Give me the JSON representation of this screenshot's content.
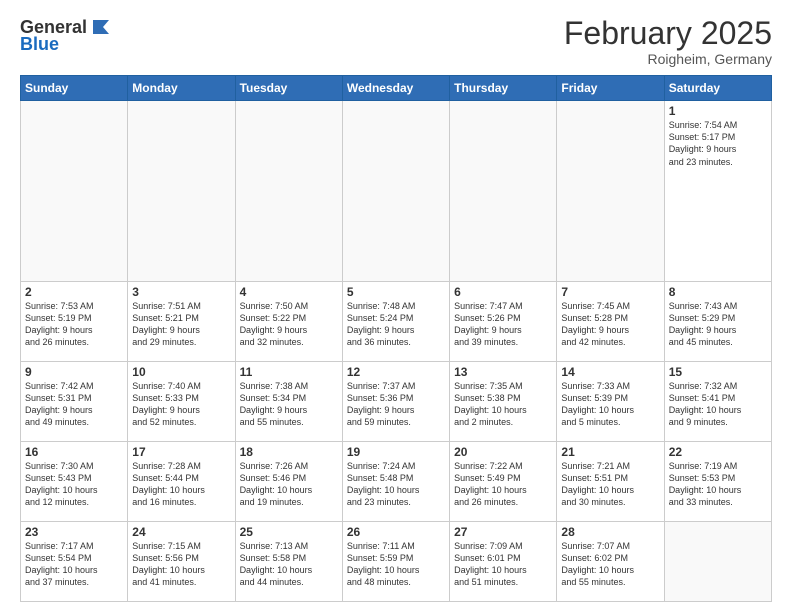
{
  "header": {
    "logo_line1": "General",
    "logo_line2": "Blue",
    "month": "February 2025",
    "location": "Roigheim, Germany"
  },
  "weekdays": [
    "Sunday",
    "Monday",
    "Tuesday",
    "Wednesday",
    "Thursday",
    "Friday",
    "Saturday"
  ],
  "weeks": [
    [
      {
        "day": "",
        "info": ""
      },
      {
        "day": "",
        "info": ""
      },
      {
        "day": "",
        "info": ""
      },
      {
        "day": "",
        "info": ""
      },
      {
        "day": "",
        "info": ""
      },
      {
        "day": "",
        "info": ""
      },
      {
        "day": "1",
        "info": "Sunrise: 7:54 AM\nSunset: 5:17 PM\nDaylight: 9 hours\nand 23 minutes."
      }
    ],
    [
      {
        "day": "2",
        "info": "Sunrise: 7:53 AM\nSunset: 5:19 PM\nDaylight: 9 hours\nand 26 minutes."
      },
      {
        "day": "3",
        "info": "Sunrise: 7:51 AM\nSunset: 5:21 PM\nDaylight: 9 hours\nand 29 minutes."
      },
      {
        "day": "4",
        "info": "Sunrise: 7:50 AM\nSunset: 5:22 PM\nDaylight: 9 hours\nand 32 minutes."
      },
      {
        "day": "5",
        "info": "Sunrise: 7:48 AM\nSunset: 5:24 PM\nDaylight: 9 hours\nand 36 minutes."
      },
      {
        "day": "6",
        "info": "Sunrise: 7:47 AM\nSunset: 5:26 PM\nDaylight: 9 hours\nand 39 minutes."
      },
      {
        "day": "7",
        "info": "Sunrise: 7:45 AM\nSunset: 5:28 PM\nDaylight: 9 hours\nand 42 minutes."
      },
      {
        "day": "8",
        "info": "Sunrise: 7:43 AM\nSunset: 5:29 PM\nDaylight: 9 hours\nand 45 minutes."
      }
    ],
    [
      {
        "day": "9",
        "info": "Sunrise: 7:42 AM\nSunset: 5:31 PM\nDaylight: 9 hours\nand 49 minutes."
      },
      {
        "day": "10",
        "info": "Sunrise: 7:40 AM\nSunset: 5:33 PM\nDaylight: 9 hours\nand 52 minutes."
      },
      {
        "day": "11",
        "info": "Sunrise: 7:38 AM\nSunset: 5:34 PM\nDaylight: 9 hours\nand 55 minutes."
      },
      {
        "day": "12",
        "info": "Sunrise: 7:37 AM\nSunset: 5:36 PM\nDaylight: 9 hours\nand 59 minutes."
      },
      {
        "day": "13",
        "info": "Sunrise: 7:35 AM\nSunset: 5:38 PM\nDaylight: 10 hours\nand 2 minutes."
      },
      {
        "day": "14",
        "info": "Sunrise: 7:33 AM\nSunset: 5:39 PM\nDaylight: 10 hours\nand 5 minutes."
      },
      {
        "day": "15",
        "info": "Sunrise: 7:32 AM\nSunset: 5:41 PM\nDaylight: 10 hours\nand 9 minutes."
      }
    ],
    [
      {
        "day": "16",
        "info": "Sunrise: 7:30 AM\nSunset: 5:43 PM\nDaylight: 10 hours\nand 12 minutes."
      },
      {
        "day": "17",
        "info": "Sunrise: 7:28 AM\nSunset: 5:44 PM\nDaylight: 10 hours\nand 16 minutes."
      },
      {
        "day": "18",
        "info": "Sunrise: 7:26 AM\nSunset: 5:46 PM\nDaylight: 10 hours\nand 19 minutes."
      },
      {
        "day": "19",
        "info": "Sunrise: 7:24 AM\nSunset: 5:48 PM\nDaylight: 10 hours\nand 23 minutes."
      },
      {
        "day": "20",
        "info": "Sunrise: 7:22 AM\nSunset: 5:49 PM\nDaylight: 10 hours\nand 26 minutes."
      },
      {
        "day": "21",
        "info": "Sunrise: 7:21 AM\nSunset: 5:51 PM\nDaylight: 10 hours\nand 30 minutes."
      },
      {
        "day": "22",
        "info": "Sunrise: 7:19 AM\nSunset: 5:53 PM\nDaylight: 10 hours\nand 33 minutes."
      }
    ],
    [
      {
        "day": "23",
        "info": "Sunrise: 7:17 AM\nSunset: 5:54 PM\nDaylight: 10 hours\nand 37 minutes."
      },
      {
        "day": "24",
        "info": "Sunrise: 7:15 AM\nSunset: 5:56 PM\nDaylight: 10 hours\nand 41 minutes."
      },
      {
        "day": "25",
        "info": "Sunrise: 7:13 AM\nSunset: 5:58 PM\nDaylight: 10 hours\nand 44 minutes."
      },
      {
        "day": "26",
        "info": "Sunrise: 7:11 AM\nSunset: 5:59 PM\nDaylight: 10 hours\nand 48 minutes."
      },
      {
        "day": "27",
        "info": "Sunrise: 7:09 AM\nSunset: 6:01 PM\nDaylight: 10 hours\nand 51 minutes."
      },
      {
        "day": "28",
        "info": "Sunrise: 7:07 AM\nSunset: 6:02 PM\nDaylight: 10 hours\nand 55 minutes."
      },
      {
        "day": "",
        "info": ""
      }
    ]
  ]
}
